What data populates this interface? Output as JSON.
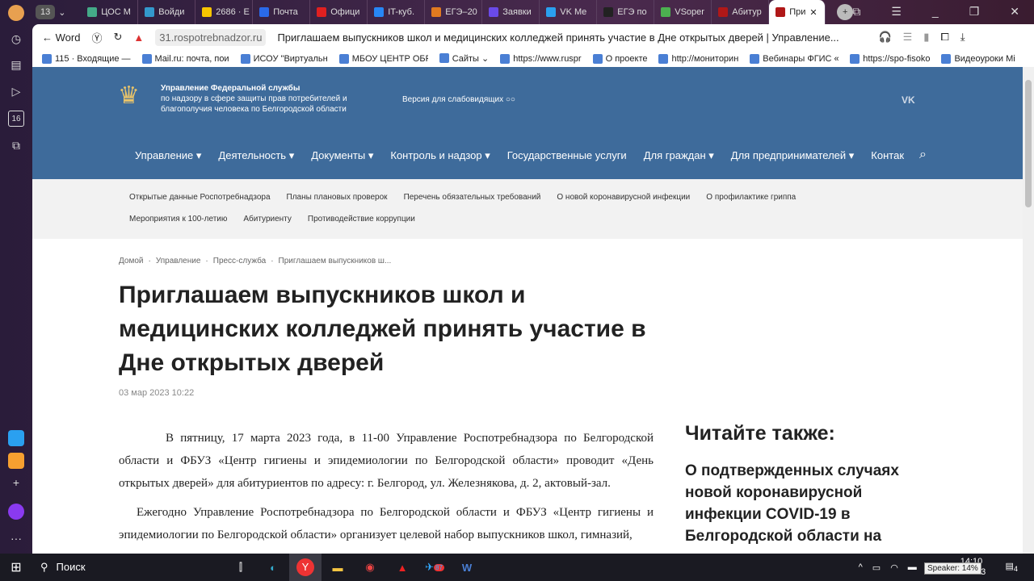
{
  "browser": {
    "tab_count": "13",
    "tabs": [
      {
        "label": "ЦОС М",
        "color": "#4a8"
      },
      {
        "label": "Войди",
        "color": "#39c"
      },
      {
        "label": "2686 · E",
        "color": "#f7c500"
      },
      {
        "label": "Почта",
        "color": "#2a6ae8"
      },
      {
        "label": "Офици",
        "color": "#e02020"
      },
      {
        "label": "IT-куб.",
        "color": "#2787f5"
      },
      {
        "label": "ЕГЭ–20",
        "color": "#e07a20"
      },
      {
        "label": "Заявки",
        "color": "#6a4ae8"
      },
      {
        "label": "VK Me",
        "color": "#2aa0f0"
      },
      {
        "label": "ЕГЭ по",
        "color": "#222"
      },
      {
        "label": "VSoper",
        "color": "#4caf50"
      },
      {
        "label": "Абитур",
        "color": "#b01818"
      },
      {
        "label": "При",
        "color": "#b01818"
      }
    ],
    "back_label": "Word",
    "url": "31.rospotrebnadzor.ru",
    "page_title": "Приглашаем выпускников школ и медицинских колледжей принять участие в Дне открытых дверей | Управление...",
    "bookmarks": [
      "115 · Входящие —",
      "Mail.ru: почта, пои",
      "ИСОУ \"Виртуальн",
      "МБОУ ЦЕНТР ОБР",
      "Сайты ⌄",
      "https://www.ruspr",
      "О проекте",
      "http://мониторин",
      "Вебинары ФГИС «",
      "https://spo-fisoko",
      "Видеоуроки Mi"
    ]
  },
  "site": {
    "org_lines": [
      "Управление Федеральной службы",
      "по надзору в сфере защиты прав потребителей и",
      "благополучия человека по Белгородской области"
    ],
    "low_vision": "Версия для слабовидящих",
    "vk": "VK",
    "nav": [
      "Управление ▾",
      "Деятельность ▾",
      "Документы ▾",
      "Контроль и надзор ▾",
      "Государственные услуги",
      "Для граждан ▾",
      "Для предпринимателей ▾",
      "Контак"
    ],
    "subnav_row1": [
      "Открытые данные Роспотребнадзора",
      "Планы плановых проверок",
      "Перечень обязательных требований",
      "О новой коронавирусной инфекции",
      "О профилактике гриппа"
    ],
    "subnav_row2": [
      "Мероприятия к 100-летию",
      "Абитуриенту",
      "Противодействие коррупции"
    ],
    "breadcrumb": [
      "Домой",
      "·",
      "Управление",
      "·",
      "Пресс-служба",
      "·",
      "Приглашаем выпускников ш..."
    ],
    "title": "Приглашаем выпускников школ и медицинских колледжей принять участие в Дне открытых дверей",
    "date": "03 мар 2023 10:22",
    "paragraphs": [
      "В пятницу, 17 марта 2023 года, в 11-00 Управление Роспотребнадзора по Белгородской области и ФБУЗ «Центр гигиены и эпидемиологии по Белгородской области» проводит «День открытых дверей» для абитуриентов по адресу: г. Белгород, ул. Железнякова, д. 2, актовый-зал.",
      "Ежегодно Управление Роспотребнадзора по Белгородской области и ФБУЗ «Центр гигиены и эпидемиологии по Белгородской области» организует целевой набор выпускников школ, гимназий,"
    ],
    "also_title": "Читайте также:",
    "also_link": "О подтвержденных случаях новой коронавирусной инфекции COVID-19 в Белгородской области на"
  },
  "taskbar": {
    "search": "Поиск",
    "time": "14:10",
    "date": "…2023",
    "tooltip": "Speaker: 14%",
    "notif": "4",
    "telegram_badge": "87"
  }
}
